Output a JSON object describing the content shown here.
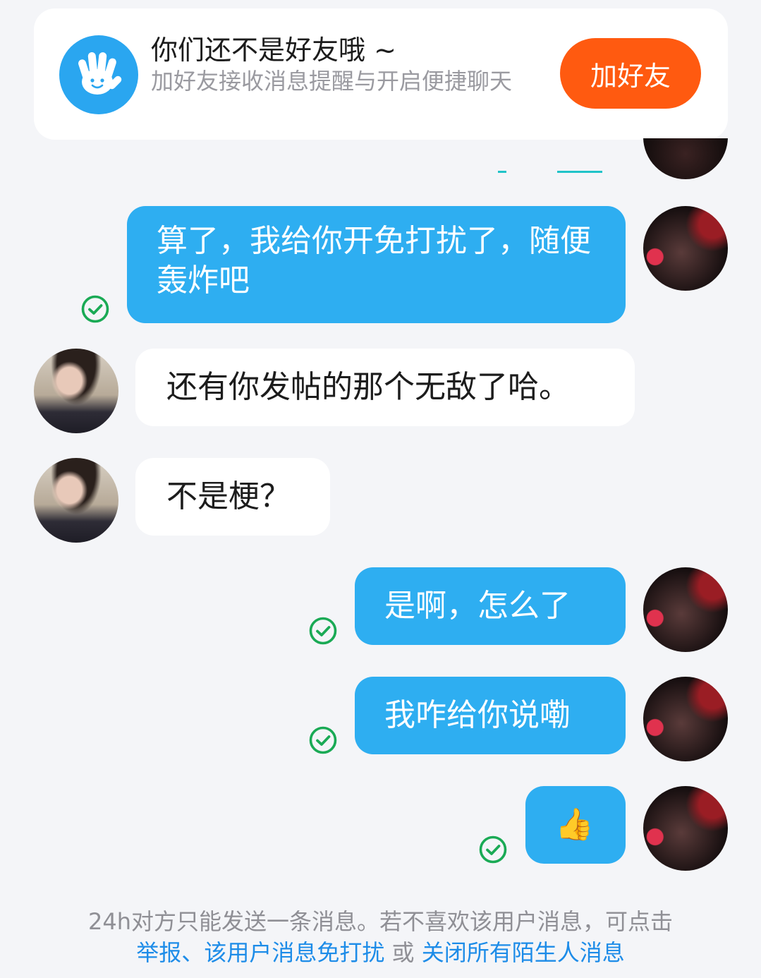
{
  "banner": {
    "title": "你们还不是好友哦 ~",
    "subtitle": "加好友接收消息提醒与开启便捷聊天",
    "add_button": "加好友",
    "icon": "waving-hand-icon"
  },
  "messages": [
    {
      "side": "out",
      "text": "算了，我给你开免打扰了，随便轰炸吧",
      "status": "read-check-icon"
    },
    {
      "side": "in",
      "text": "还有你发帖的那个无敌了哈。"
    },
    {
      "side": "in",
      "text": "不是梗？"
    },
    {
      "side": "out",
      "text": "是啊，怎么了",
      "status": "read-check-icon"
    },
    {
      "side": "out",
      "text": "我咋给你说嘞",
      "status": "read-check-icon"
    },
    {
      "side": "out",
      "text": "👍",
      "status": "read-check-icon"
    }
  ],
  "footer": {
    "notice": "24h对方只能发送一条消息。若不喜欢该用户消息，可点击",
    "report_link": "举报",
    "sep": "、",
    "mute_link": "该用户消息免打扰",
    "or": " 或 ",
    "close_link": "关闭所有陌生人消息"
  },
  "colors": {
    "outgoing_bubble": "#2eaef1",
    "incoming_bubble": "#ffffff",
    "add_button": "#ff5a10",
    "check": "#1aaa55",
    "link": "#1d8ce8"
  }
}
